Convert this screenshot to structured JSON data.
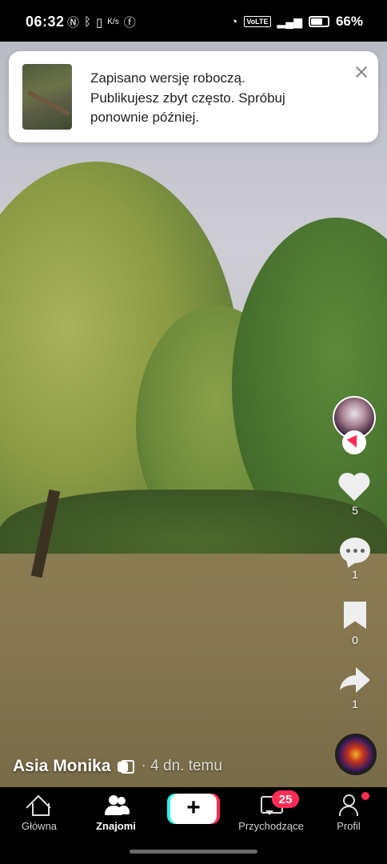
{
  "status_bar": {
    "time": "06:32",
    "left_icons": [
      "nfc-icon",
      "bluetooth-icon",
      "vibrate-icon",
      "data-speed-icon",
      "facebook-icon"
    ],
    "speed_label": "K/s",
    "volte": "VoLTE",
    "battery": "66%",
    "battery_level": 0.66
  },
  "toast": {
    "line1": "Zapisano wersję roboczą.",
    "line2": "Publikujesz zbyt często. Spróbuj",
    "line3": "ponownie później."
  },
  "post": {
    "author": "Asia Monika",
    "time_ago": "· 4 dn. temu",
    "likes": "5",
    "comments": "1",
    "saves": "0",
    "shares": "1"
  },
  "nav": {
    "home": "Główna",
    "friends": "Znajomi",
    "create": "+",
    "inbox": "Przychodzące",
    "inbox_badge": "25",
    "profile": "Profil"
  },
  "colors": {
    "accent_red": "#fe2c55",
    "accent_cyan": "#25f4ee"
  }
}
